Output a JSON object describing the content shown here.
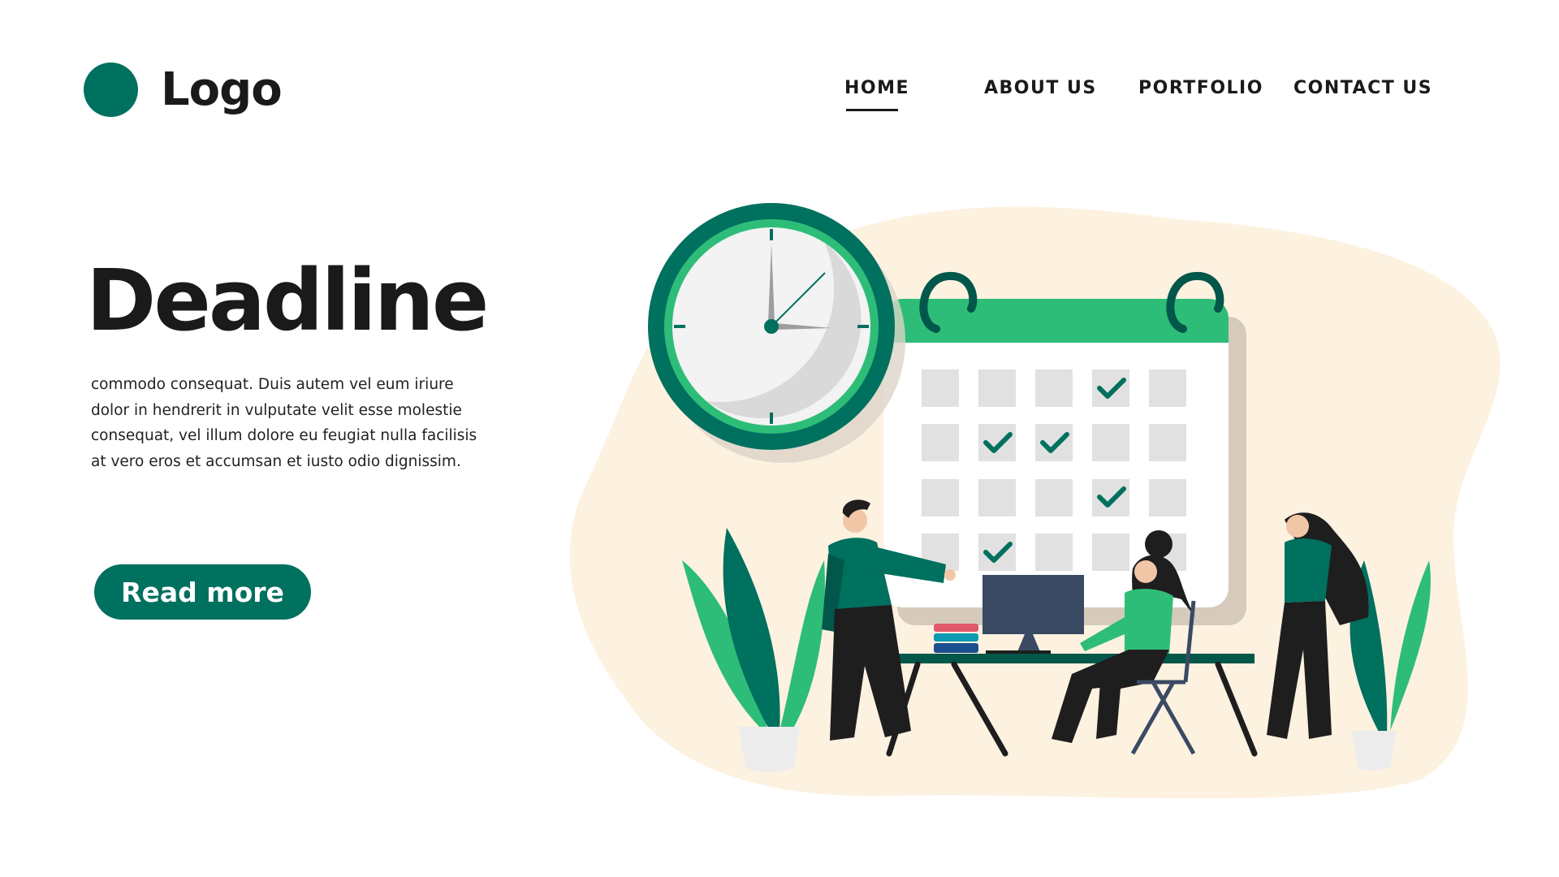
{
  "brand": {
    "logo_text": "Logo",
    "accent": "#00705f",
    "accent_light": "#2ebd78",
    "blob": "#fdf1e0"
  },
  "nav": {
    "items": [
      {
        "label": "HOME",
        "active": true
      },
      {
        "label": "ABOUT US"
      },
      {
        "label": "PORTFOLIO"
      },
      {
        "label": "CONTACT US"
      }
    ]
  },
  "hero": {
    "title": "Deadline",
    "body_lines": [
      "commodo consequat. Duis autem vel eum iriure",
      "dolor in hendrerit in vulputate velit esse molestie",
      "consequat, vel illum dolore eu feugiat nulla facilisis",
      "at vero eros et accumsan et iusto odio dignissim."
    ],
    "cta_label": "Read more"
  },
  "illustration": {
    "icons": [
      "clock-icon",
      "calendar-icon",
      "checkmark-icon",
      "plant-icon",
      "computer-monitor-icon",
      "book-stack-icon"
    ],
    "calendar_checked_cells": [
      [
        0,
        3
      ],
      [
        1,
        1
      ],
      [
        1,
        2
      ],
      [
        2,
        3
      ],
      [
        3,
        1
      ]
    ]
  }
}
